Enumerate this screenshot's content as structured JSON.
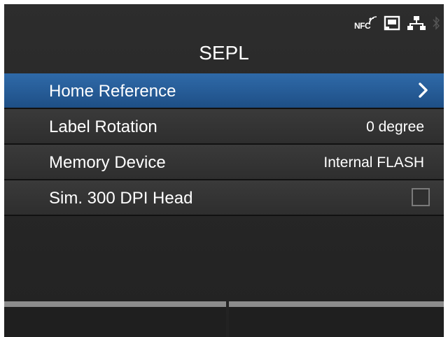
{
  "status": {
    "nfc_label": "NFC",
    "icons": [
      "nfc-icon",
      "sd-card-icon",
      "network-icon",
      "bluetooth-icon"
    ]
  },
  "title": "SEPL",
  "menu": {
    "items": [
      {
        "label": "Home Reference",
        "value": "",
        "control": "chevron",
        "selected": true
      },
      {
        "label": "Label Rotation",
        "value": "0 degree",
        "control": "value",
        "selected": false
      },
      {
        "label": "Memory Device",
        "value": "Internal FLASH",
        "control": "value",
        "selected": false
      },
      {
        "label": "Sim. 300 DPI Head",
        "value": "",
        "control": "checkbox",
        "checked": false,
        "selected": false
      }
    ]
  },
  "footer": {
    "left_label": "",
    "right_label": ""
  },
  "colors": {
    "selection": "#2a5f9a",
    "background": "#2b2b2b",
    "text": "#ffffff"
  }
}
